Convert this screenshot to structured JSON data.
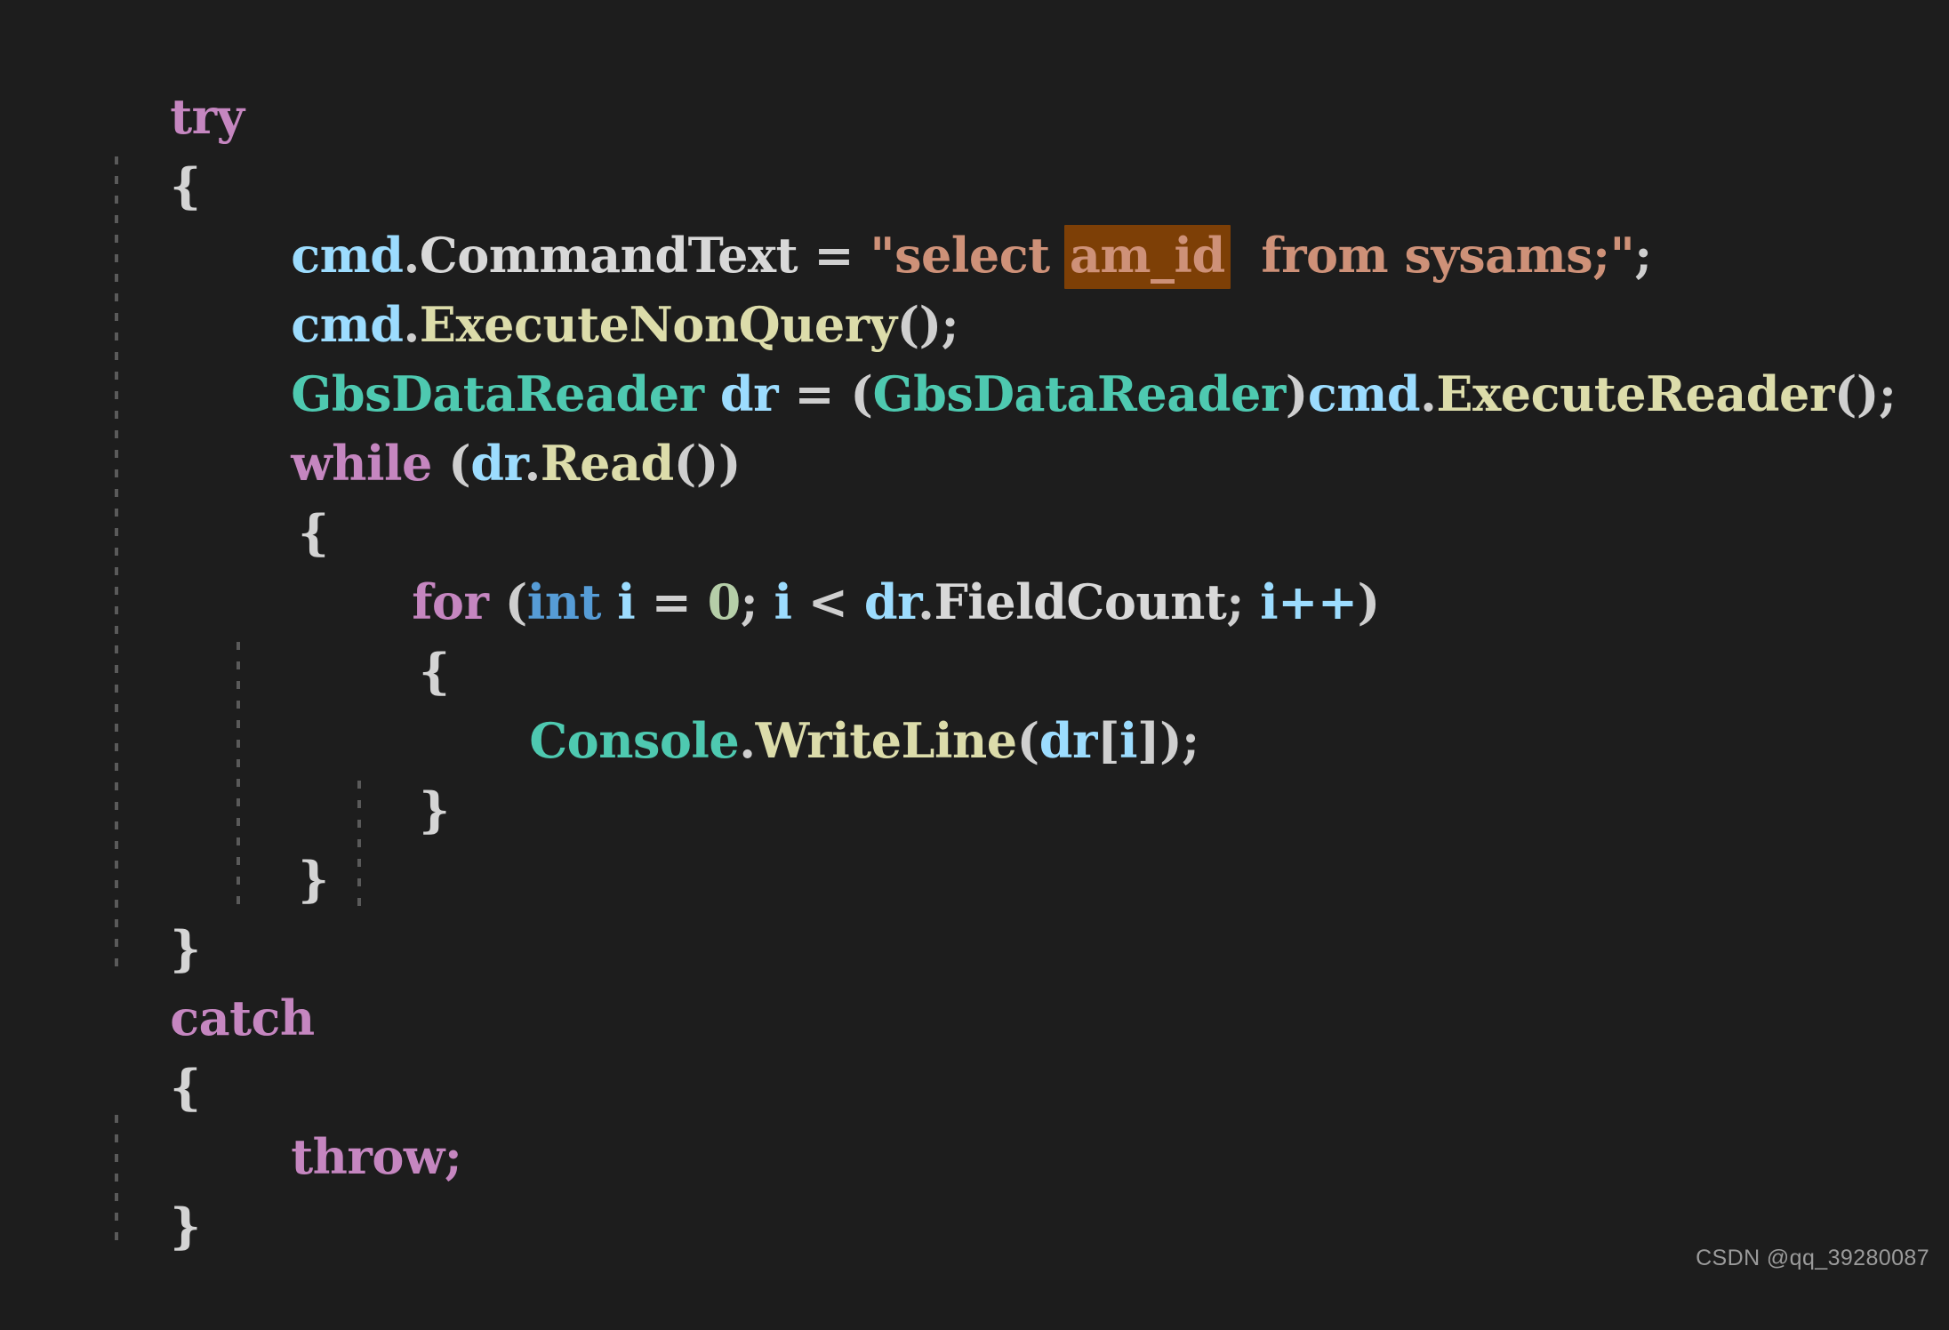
{
  "editor": {
    "background": "#1d1d1d",
    "language": "csharp",
    "indent_guide_color": "#5a5a5a",
    "highlight_background": "#7d3f06"
  },
  "colors": {
    "keyword": "#c586c0",
    "type": "#4ec9b0",
    "builtin_type": "#569cd6",
    "variable": "#9cdcfe",
    "property": "#d8d8d8",
    "function": "#dcdcaa",
    "string": "#ce9178",
    "number": "#b5cea8",
    "punctuation": "#cfcfcf",
    "foreground": "#d4d4d4"
  },
  "code": {
    "lines": [
      {
        "indent": 0,
        "text": "try"
      },
      {
        "indent": 0,
        "text": "{"
      },
      {
        "indent": 1,
        "text": "cmd.CommandText = \"select am_id  from sysams;\";"
      },
      {
        "indent": 1,
        "text": "cmd.ExecuteNonQuery();"
      },
      {
        "indent": 1,
        "text": "GbsDataReader dr = (GbsDataReader)cmd.ExecuteReader();"
      },
      {
        "indent": 1,
        "text": "while (dr.Read())"
      },
      {
        "indent": 1,
        "text": "{"
      },
      {
        "indent": 2,
        "text": "for (int i = 0; i < dr.FieldCount; i++)"
      },
      {
        "indent": 2,
        "text": "{"
      },
      {
        "indent": 3,
        "text": "Console.WriteLine(dr[i]);"
      },
      {
        "indent": 2,
        "text": "}"
      },
      {
        "indent": 1,
        "text": "}"
      },
      {
        "indent": 0,
        "text": "}"
      },
      {
        "indent": 0,
        "text": "catch"
      },
      {
        "indent": 0,
        "text": "{"
      },
      {
        "indent": 1,
        "text": "throw;"
      },
      {
        "indent": 0,
        "text": "}"
      }
    ],
    "highlighted_token": "am_id",
    "line_1_try": "try",
    "line_2_open": "{",
    "line_3": {
      "obj": "cmd",
      "dot": ".",
      "prop": "CommandText",
      "eq": " = ",
      "quote_open": "\"",
      "str_pre": "select ",
      "str_hl": "am_id",
      "str_post": "  from sysams;",
      "quote_close": "\"",
      "semi": ";"
    },
    "line_4": {
      "obj": "cmd",
      "dot": ".",
      "func": "ExecuteNonQuery",
      "parens": "();"
    },
    "line_5": {
      "type": "GbsDataReader",
      "var": " dr",
      "eq": " = ",
      "cast_open": "(",
      "cast_type": "GbsDataReader",
      "cast_close": ")",
      "obj": "cmd",
      "dot": ".",
      "func": "ExecuteReader",
      "parens": "();"
    },
    "line_6": {
      "kw": "while",
      "open": " (",
      "var": "dr",
      "dot": ".",
      "func": "Read",
      "close": "())"
    },
    "line_7_open": "{",
    "line_8": {
      "kw": "for",
      "open": " (",
      "btype": "int",
      "var_i": " i",
      "eq": " = ",
      "num": "0",
      "semi1": "; ",
      "var_i2": "i",
      "lt": " < ",
      "var_dr": "dr",
      "dot": ".",
      "prop": "FieldCount",
      "semi2": "; ",
      "inc": "i++",
      "close": ")"
    },
    "line_9_open": "{",
    "line_10": {
      "type": "Console",
      "dot": ".",
      "func": "WriteLine",
      "open": "(",
      "var": "dr",
      "br_open": "[",
      "idx": "i",
      "br_close": "]",
      "close": ");"
    },
    "line_11_close": "}",
    "line_12_close": "}",
    "line_13_close": "}",
    "line_14_catch": "catch",
    "line_15_open": "{",
    "line_16_throw": "throw;",
    "line_17_close": "}"
  },
  "watermark": {
    "text": "CSDN @qq_39280087"
  }
}
